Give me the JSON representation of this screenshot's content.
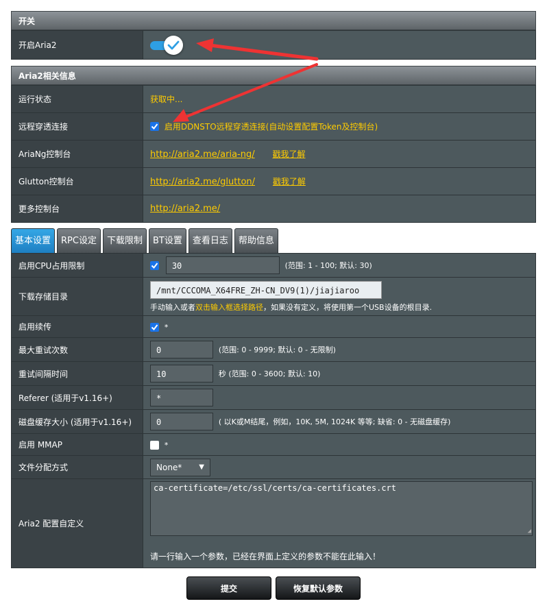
{
  "switch_section": {
    "title": "开关",
    "enable_label": "开启Aria2"
  },
  "info_section": {
    "title": "Aria2相关信息",
    "rows": {
      "status_label": "运行状态",
      "status_value": "获取中...",
      "remote_label": "远程穿透连接",
      "remote_text": "启用DDNSTO远程穿透连接(自动设置配置Token及控制台)",
      "ariang_label": "AriaNg控制台",
      "ariang_link": "http://aria2.me/aria-ng/",
      "ariang_more": "戳我了解",
      "glutton_label": "Glutton控制台",
      "glutton_link": "http://aria2.me/glutton/",
      "glutton_more": "戳我了解",
      "more_label": "更多控制台",
      "more_link": "http://aria2.me/"
    }
  },
  "tabs": [
    "基本设置",
    "RPC设定",
    "下载限制",
    "BT设置",
    "查看日志",
    "帮助信息"
  ],
  "settings": {
    "cpu_label": "启用CPU占用限制",
    "cpu_value": "30",
    "cpu_hint": "(范围: 1 - 100; 默认: 30)",
    "dir_label": "下载存储目录",
    "dir_value": "/mnt/CCCOMA_X64FRE_ZH-CN_DV9(1)/jiajiaroo",
    "dir_hint_1": "手动输入或者",
    "dir_hint_2": "双击输入框选择路径",
    "dir_hint_3": "，如果没有定义，将使用第一个USB设备的根目录.",
    "resume_label": "启用续传",
    "resume_star": "*",
    "retry_label": "最大重试次数",
    "retry_value": "0",
    "retry_hint": "(范围: 0 - 9999; 默认: 0 - 无限制)",
    "interval_label": "重试间隔时间",
    "interval_value": "10",
    "interval_hint": "秒 (范围: 0 - 3600; 默认: 10)",
    "referer_label": "Referer (适用于v1.16+)",
    "referer_value": "*",
    "cache_label": "磁盘缓存大小 (适用于v1.16+)",
    "cache_value": "0",
    "cache_hint": "( 以K或M结尾，例如，10K, 5M, 1024K 等等; 缺省: 0 - 无磁盘缓存)",
    "mmap_label": "启用 MMAP",
    "mmap_star": "*",
    "alloc_label": "文件分配方式",
    "alloc_value": "None*",
    "custom_label": "Aria2 配置自定义",
    "custom_value": "ca-certificate=/etc/ssl/certs/ca-certificates.crt",
    "custom_hint": "请一行输入一个参数，已经在界面上定义的参数不能在此输入！"
  },
  "buttons": {
    "submit": "提交",
    "restore": "恢复默认参数"
  },
  "colors": {
    "accent": "#2e9fe4",
    "link": "#ffcc00",
    "arrow": "#ee3333"
  }
}
